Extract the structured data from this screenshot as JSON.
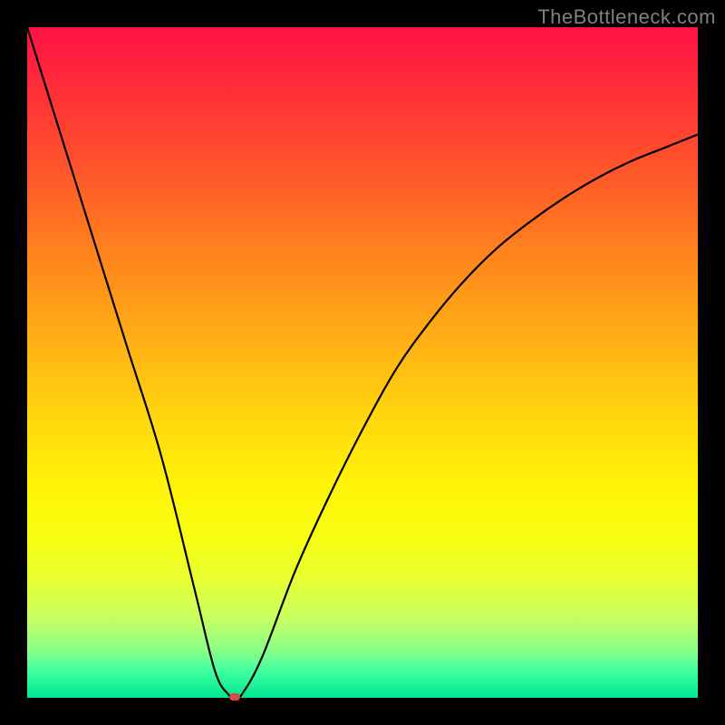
{
  "watermark": "TheBottleneck.com",
  "chart_data": {
    "type": "line",
    "title": "",
    "xlabel": "",
    "ylabel": "",
    "xlim": [
      0,
      100
    ],
    "ylim": [
      0,
      100
    ],
    "grid": false,
    "legend": false,
    "series": [
      {
        "name": "bottleneck-curve",
        "x": [
          0,
          5,
          10,
          15,
          20,
          25,
          28,
          30,
          31,
          32,
          35,
          40,
          45,
          50,
          55,
          60,
          65,
          70,
          75,
          80,
          85,
          90,
          95,
          100
        ],
        "values": [
          100,
          84,
          68,
          52,
          36,
          16,
          4,
          0.5,
          0,
          0.5,
          6,
          19,
          30,
          40,
          49,
          56,
          62,
          67,
          71,
          74.5,
          77.5,
          80,
          82,
          84
        ]
      }
    ],
    "marker": {
      "x": 31,
      "y": 0
    },
    "gradient_colors": {
      "top": "#ff1244",
      "bottom": "#00e890"
    }
  }
}
